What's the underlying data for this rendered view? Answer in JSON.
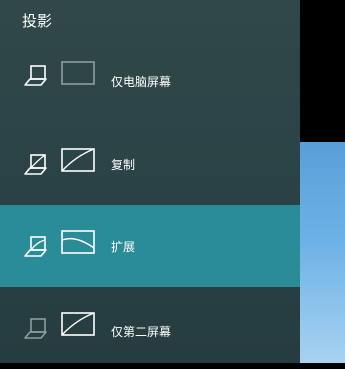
{
  "panel": {
    "title": "投影",
    "selected_index": 2,
    "options": [
      {
        "label": "仅电脑屏幕",
        "icon": "pc-screen-only-icon"
      },
      {
        "label": "复制",
        "icon": "duplicate-icon"
      },
      {
        "label": "扩展",
        "icon": "extend-icon"
      },
      {
        "label": "仅第二屏幕",
        "icon": "second-screen-only-icon"
      }
    ]
  },
  "colors": {
    "panel_bg": "#2c4548",
    "selected_bg": "#2a8c96",
    "text": "#ffffff",
    "icon_dim": "#8e9ea0"
  }
}
